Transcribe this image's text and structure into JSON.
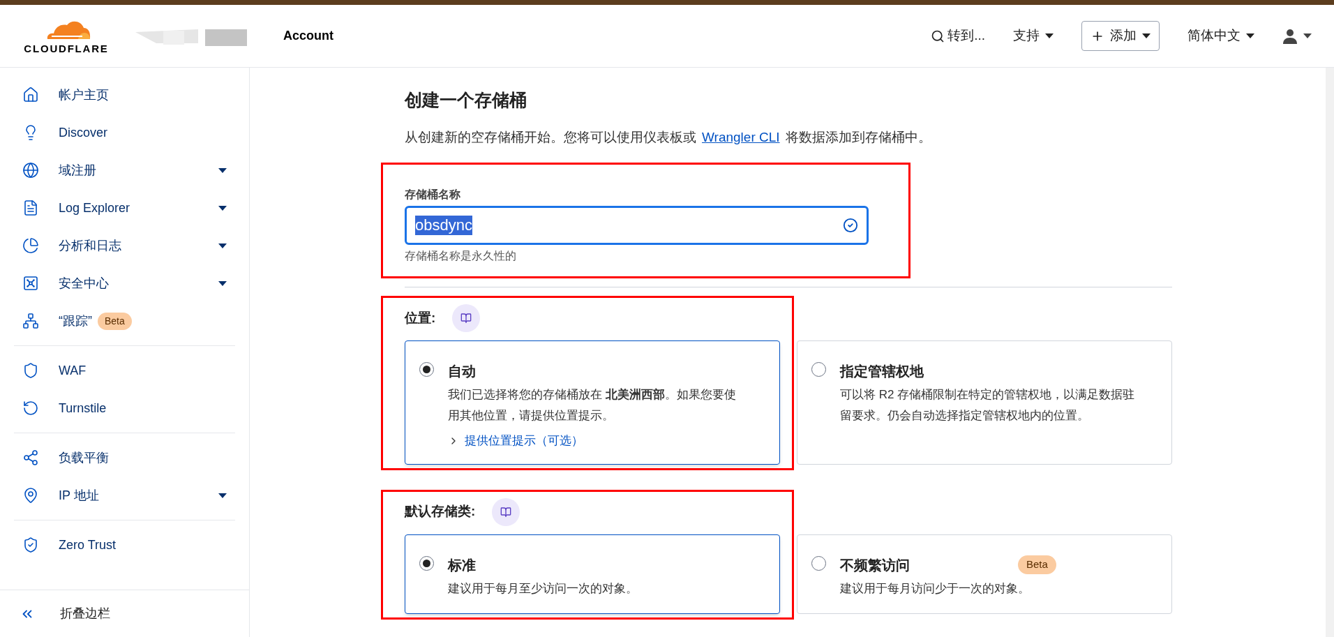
{
  "header": {
    "brand": "CLOUDFLARE",
    "account": "Account",
    "nav": [
      {
        "kind": "search",
        "label": "转到..."
      },
      {
        "kind": "menu",
        "label": "支持"
      },
      {
        "kind": "add",
        "label": "添加"
      },
      {
        "kind": "menu",
        "label": "简体中文"
      },
      {
        "kind": "user"
      }
    ]
  },
  "sidebar": {
    "groups": [
      [
        {
          "label": "帐户主页",
          "expandable": false
        },
        {
          "label": "Discover",
          "expandable": false
        },
        {
          "label": "域注册",
          "expandable": true
        },
        {
          "label": "Log Explorer",
          "expandable": true
        },
        {
          "label": "分析和日志",
          "expandable": true
        },
        {
          "label": "安全中心",
          "expandable": true
        },
        {
          "label": "“跟踪”",
          "expandable": false,
          "badge": "Beta"
        }
      ],
      [
        {
          "label": "WAF",
          "expandable": false
        },
        {
          "label": "Turnstile",
          "expandable": false
        }
      ],
      [
        {
          "label": "负载平衡",
          "expandable": false
        },
        {
          "label": "IP 地址",
          "expandable": true
        }
      ],
      [
        {
          "label": "Zero Trust",
          "expandable": false
        }
      ]
    ],
    "collapse": "折叠边栏"
  },
  "main": {
    "title": "创建一个存储桶",
    "intro_before": "从创建新的空存储桶开始。您将可以使用仪表板或",
    "intro_link": "Wrangler CLI",
    "intro_after": "将数据添加到存储桶中。",
    "name_field": {
      "label": "存储桶名称",
      "value": "obsdync",
      "hint": "存储桶名称是永久性的",
      "valid": true
    },
    "location": {
      "label": "位置:",
      "options": [
        {
          "title": "自动",
          "description": "我们已选择将您的存储桶放在 **北美洲西部**。如果您要使用其他位置，请提供位置提示。",
          "link": "提供位置提示（可选）",
          "selected": true
        },
        {
          "title": "指定管辖权地",
          "description": "可以将 R2 存储桶限制在特定的管辖权地，以满足数据驻留要求。仍会自动选择指定管辖权地内的位置。",
          "selected": false
        }
      ]
    },
    "storage_class": {
      "label": "默认存储类:",
      "options": [
        {
          "title": "标准",
          "description": "建议用于每月至少访问一次的对象。",
          "selected": true
        },
        {
          "title": "不频繁访问",
          "description": "建议用于每月访问少于一次的对象。",
          "badge": "Beta",
          "selected": false
        }
      ]
    }
  }
}
